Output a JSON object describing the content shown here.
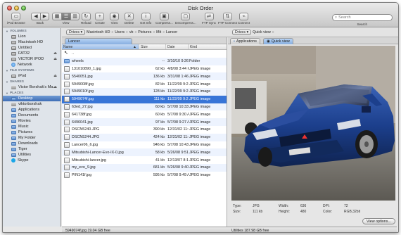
{
  "window": {
    "title": "Disk Order"
  },
  "toolbar": {
    "ipod_browse": "iPod Browse",
    "back": "Back",
    "view": "View",
    "reload": "Reload",
    "create": "Create",
    "view2": "View",
    "delete": "Delete",
    "get_info": "Get Info",
    "compress": "Compress...",
    "decompress": "Decompress...",
    "ftp_sync": "FTP Sync",
    "ftp_connect": "FTP Connect",
    "connect": "Connect",
    "search_label": "Search",
    "search_placeholder": "Search"
  },
  "sidebar": {
    "volumes_header": "VOLUMES",
    "volumes": [
      {
        "label": "Lion",
        "icon": "drive-icon",
        "eject": false
      },
      {
        "label": "Macintosh HD",
        "icon": "drive-icon",
        "eject": false
      },
      {
        "label": "Untitled",
        "icon": "drive-icon",
        "eject": false
      },
      {
        "label": "FAT32",
        "icon": "drive-icon",
        "eject": true
      },
      {
        "label": "VICTOR IPOD",
        "icon": "ipod-icon",
        "eject": true
      },
      {
        "label": "Network",
        "icon": "network-icon",
        "eject": false
      }
    ],
    "filesystems_header": "FILE SYSTEMS",
    "filesystems": [
      {
        "label": "iPod",
        "eject": true
      }
    ],
    "shares_header": "SHARES",
    "shares": [
      {
        "label": "Victor Borshak's Ma...",
        "eject": true
      }
    ],
    "places_header": "PLACES",
    "places": [
      {
        "label": "Desktop"
      },
      {
        "label": "viktorborshak"
      },
      {
        "label": "Applications"
      },
      {
        "label": "Documents"
      },
      {
        "label": "Movies"
      },
      {
        "label": "Music"
      },
      {
        "label": "Pictures"
      },
      {
        "label": "My Folder"
      },
      {
        "label": "Downloads"
      },
      {
        "label": "Tiger"
      },
      {
        "label": "Utilities"
      },
      {
        "label": "Skype"
      }
    ]
  },
  "left_path": {
    "drives_label": "Drives",
    "crumbs": [
      "Macintosh HD",
      "Users",
      "vb",
      "Pictures",
      "Mit",
      "Lancer"
    ]
  },
  "left_tab": "Lancer",
  "columns": {
    "name": "Name",
    "size": "Size",
    "date": "Date",
    "kind": "Kind"
  },
  "files": [
    {
      "name": "..",
      "size": "",
      "date": "",
      "kind": "",
      "type": "up"
    },
    {
      "name": "wheels",
      "size": "--",
      "date": "3/10/10 9:26 P",
      "kind": "Folder",
      "type": "folder"
    },
    {
      "name": "131010890_1.jpg",
      "size": "62 kb",
      "date": "4/8/08 3:44 PM",
      "kind": "JPEG image",
      "type": "file"
    },
    {
      "name": "5540051.jpg",
      "size": "136 kb",
      "date": "3/31/08 1:46 P",
      "kind": "JPEG image",
      "type": "file"
    },
    {
      "name": "5949008f.jpg",
      "size": "82 kb",
      "date": "11/22/09 9:24 P",
      "kind": "JPEG image",
      "type": "file"
    },
    {
      "name": "5949010f.jpg",
      "size": "128 kb",
      "date": "11/22/09 9:24 P",
      "kind": "JPEG image",
      "type": "file"
    },
    {
      "name": "5949074f.jpg",
      "size": "111 kb",
      "date": "11/22/09 9:23 P",
      "kind": "JPEG image",
      "type": "file",
      "selected": true
    },
    {
      "name": "63ed_27.jpg",
      "size": "60 kb",
      "date": "5/7/08 10:33 A",
      "kind": "JPEG image",
      "type": "file"
    },
    {
      "name": "641738f.jpg",
      "size": "60 kb",
      "date": "5/7/08 9:30 AM",
      "kind": "JPEG image",
      "type": "file"
    },
    {
      "name": "6496041.jpg",
      "size": "97 kb",
      "date": "5/7/08 9:27 AM",
      "kind": "JPEG image",
      "type": "file"
    },
    {
      "name": "DSCN5240.JPG",
      "size": "390 kb",
      "date": "12/31/02 11:0C",
      "kind": "JPEG image",
      "type": "file"
    },
    {
      "name": "DSCN5244.JPG",
      "size": "424 kb",
      "date": "12/31/02 11:0C",
      "kind": "JPEG image",
      "type": "file"
    },
    {
      "name": "Lancer06_6.jpg",
      "size": "946 kb",
      "date": "5/7/08 10:43 A",
      "kind": "JPEG image",
      "type": "file"
    },
    {
      "name": "Mitsubishi-Lancer-Evo-IX-0.jpg",
      "size": "58 kb",
      "date": "5/26/08 9:51 P",
      "kind": "JPEG image",
      "type": "file"
    },
    {
      "name": "Mitsubishi-lancer.jpg",
      "size": "41 kb",
      "date": "12/13/07 8:16",
      "kind": "JPEG image",
      "type": "file"
    },
    {
      "name": "my_evo_9.jpg",
      "size": "681 kb",
      "date": "5/26/08 9:40 P",
      "kind": "JPEG image",
      "type": "file"
    },
    {
      "name": "PIN141f.jpg",
      "size": "595 kb",
      "date": "5/7/08 9:49 AM",
      "kind": "JPEG image",
      "type": "file"
    }
  ],
  "left_status": "5949074f.jpg  19.04 GB free",
  "right_path": {
    "drives_label": "Drives",
    "quick_view": "Quick view"
  },
  "right_tabs": [
    "Applications",
    "Quick view"
  ],
  "preview_info": {
    "type_label": "Type:",
    "type_value": "JPG",
    "size_label": "Size:",
    "size_value": "111 kb",
    "width_label": "Width:",
    "width_value": "636",
    "height_label": "Height:",
    "height_value": "480",
    "dpi_label": "DPI:",
    "dpi_value": "72",
    "color_label": "Color:",
    "color_value": "RGB,32bit"
  },
  "view_options": "View options...",
  "right_status": "Utilities  187.98 GB free",
  "colors": {
    "selection": "#3875d7",
    "tab_active": "#9cc0ec",
    "car_body": "#1c3f8c"
  }
}
